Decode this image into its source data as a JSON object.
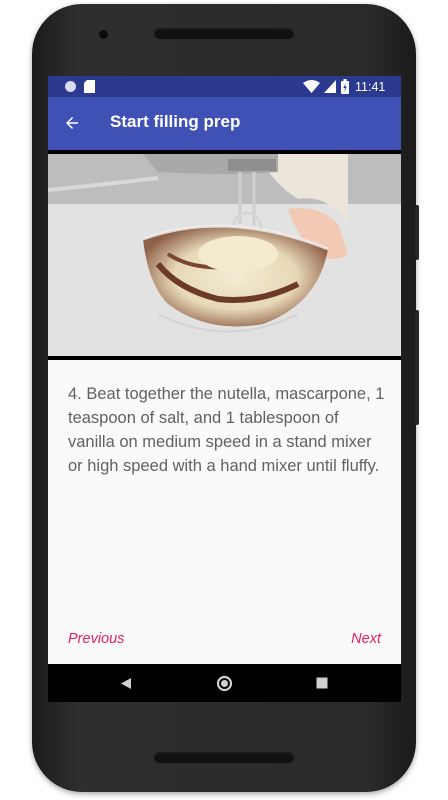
{
  "status_bar": {
    "time": "11:41",
    "left_icons": [
      "circle-notification-icon",
      "sd-card-icon"
    ],
    "right_icons": [
      "wifi-icon",
      "cell-signal-icon",
      "battery-icon"
    ]
  },
  "app_bar": {
    "title": "Start filling prep",
    "back_icon": "arrow-back-icon",
    "color": "#3f51b5",
    "status_color": "#2b3a8f"
  },
  "step": {
    "media_description": "",
    "text": "4. Beat together the nutella, mascarpone, 1 teaspoon of salt, and 1 tablespoon of vanilla on medium speed in a stand mixer or high speed with a hand mixer until fluffy."
  },
  "navigation": {
    "previous_label": "Previous",
    "next_label": "Next",
    "accent_color": "#e91e63"
  },
  "system_nav": {
    "buttons": [
      "back-triangle-icon",
      "home-circle-icon",
      "recents-square-icon"
    ]
  }
}
